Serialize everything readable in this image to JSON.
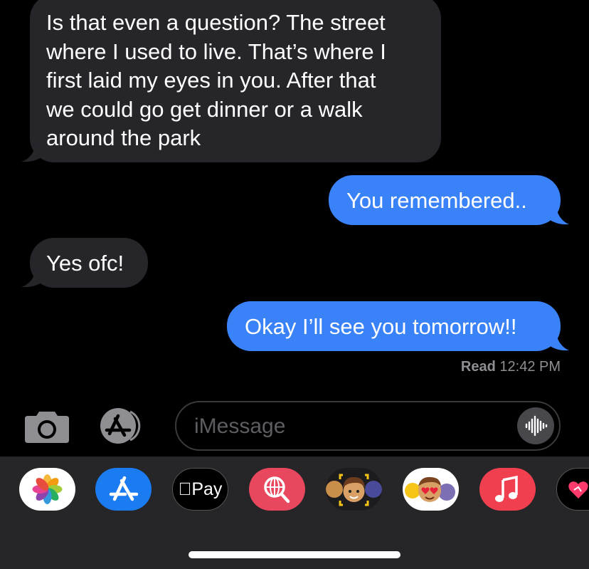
{
  "conversation": {
    "messages": [
      {
        "direction": "incoming",
        "text": "Is that even a question? The street\nwhere I used to live. That’s where I\nfirst laid my eyes in you. After that\nwe could go get dinner or a walk\naround the park"
      },
      {
        "direction": "outgoing",
        "text": "You remembered.."
      },
      {
        "direction": "incoming",
        "text": "Yes ofc!"
      },
      {
        "direction": "outgoing",
        "text": "Okay I’ll see you tomorrow!!"
      }
    ],
    "receipt": {
      "status": "Read",
      "time": "12:42 PM"
    }
  },
  "compose": {
    "placeholder": "iMessage",
    "camera_icon": "camera-icon",
    "apps_icon": "app-store-icon",
    "audio_icon": "waveform-icon"
  },
  "app_drawer": {
    "apps": [
      {
        "name": "photos-app",
        "icon": "photos-icon"
      },
      {
        "name": "app-store-app",
        "icon": "app-store-icon"
      },
      {
        "name": "apple-pay-app",
        "icon": "apple-pay-icon",
        "label": "Pay"
      },
      {
        "name": "image-search-app",
        "icon": "globe-search-icon"
      },
      {
        "name": "memoji-app",
        "icon": "memoji-icon"
      },
      {
        "name": "memoji-stickers-app",
        "icon": "memoji-stickers-icon"
      },
      {
        "name": "music-app",
        "icon": "music-icon"
      },
      {
        "name": "digital-touch-app",
        "icon": "heart-icon"
      }
    ]
  },
  "colors": {
    "incoming_bubble": "#26252a",
    "outgoing_bubble": "#3a82f7",
    "background": "#000000",
    "drawer": "#262629"
  }
}
